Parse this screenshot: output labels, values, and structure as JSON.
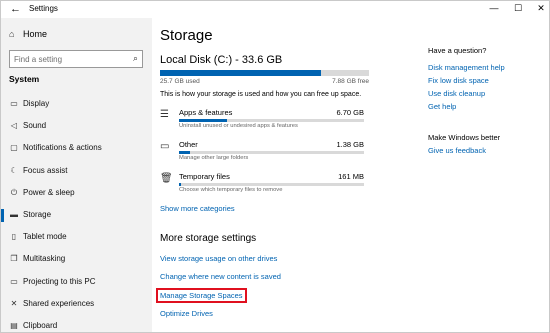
{
  "titlebar": {
    "back_glyph": "←",
    "title": "Settings",
    "min_glyph": "—",
    "max_glyph": "☐",
    "close_glyph": "✕"
  },
  "nav": {
    "home_label": "Home",
    "search_placeholder": "Find a setting",
    "section_label": "System",
    "items": [
      {
        "label": "Display",
        "icon": "display-icon",
        "glyph": "▭"
      },
      {
        "label": "Sound",
        "icon": "sound-icon",
        "glyph": "◁"
      },
      {
        "label": "Notifications & actions",
        "icon": "notifications-icon",
        "glyph": "▢"
      },
      {
        "label": "Focus assist",
        "icon": "focus-assist-icon",
        "glyph": "☾"
      },
      {
        "label": "Power & sleep",
        "icon": "power-icon",
        "glyph": "⏻"
      },
      {
        "label": "Storage",
        "icon": "storage-icon",
        "glyph": "▬",
        "active": true
      },
      {
        "label": "Tablet mode",
        "icon": "tablet-icon",
        "glyph": "▯"
      },
      {
        "label": "Multitasking",
        "icon": "multitasking-icon",
        "glyph": "❐"
      },
      {
        "label": "Projecting to this PC",
        "icon": "projecting-icon",
        "glyph": "▭"
      },
      {
        "label": "Shared experiences",
        "icon": "shared-icon",
        "glyph": "✕"
      },
      {
        "label": "Clipboard",
        "icon": "clipboard-icon",
        "glyph": "▤"
      }
    ]
  },
  "main": {
    "page_title": "Storage",
    "disk_title": "Local Disk (C:) - 33.6 GB",
    "usage_fraction": 0.77,
    "used_text": "25.7 GB used",
    "free_text": "7.88 GB free",
    "description": "This is how your storage is used and how you can free up space.",
    "categories": [
      {
        "name": "Apps & features",
        "size": "6.70 GB",
        "sub": "Uninstall unused or undesired apps & features",
        "fraction": 0.26,
        "icon": "apps-icon"
      },
      {
        "name": "Other",
        "size": "1.38 GB",
        "sub": "Manage other large folders",
        "fraction": 0.06,
        "icon": "other-icon"
      },
      {
        "name": "Temporary files",
        "size": "161 MB",
        "sub": "Choose which temporary files to remove",
        "fraction": 0.01,
        "icon": "trash-icon"
      }
    ],
    "show_more_label": "Show more categories",
    "more_settings_title": "More storage settings",
    "links": [
      "View storage usage on other drives",
      "Change where new content is saved",
      "Manage Storage Spaces",
      "Optimize Drives"
    ]
  },
  "side": {
    "question_heading": "Have a question?",
    "question_links": [
      "Disk management help",
      "Fix low disk space",
      "Use disk cleanup",
      "Get help"
    ],
    "better_heading": "Make Windows better",
    "feedback_link": "Give us feedback"
  },
  "colors": {
    "accent": "#0063b1",
    "highlight": "#e0101f",
    "nav_bg": "#f2f2f2"
  }
}
